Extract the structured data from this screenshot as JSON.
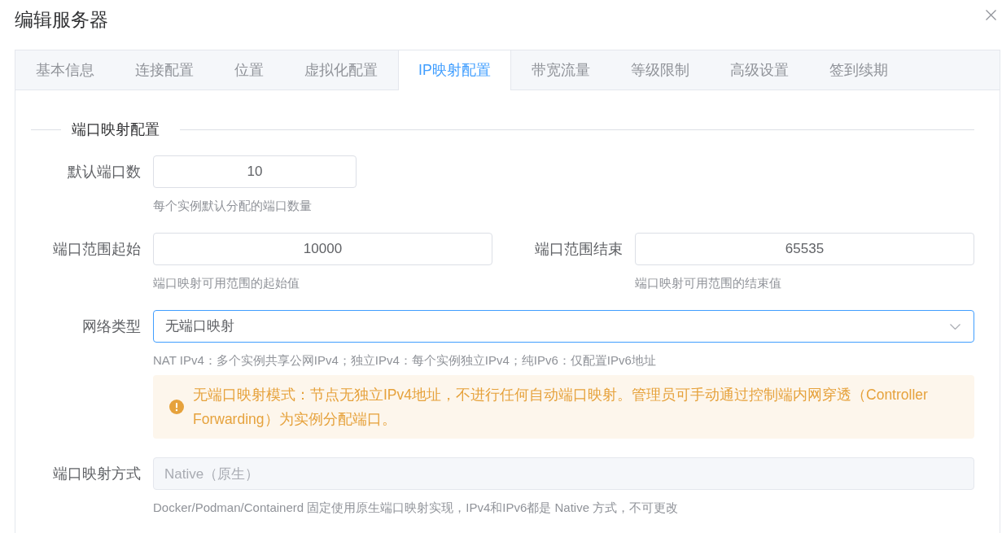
{
  "dialog": {
    "title": "编辑服务器"
  },
  "tabs": [
    {
      "label": "基本信息",
      "selected": false
    },
    {
      "label": "连接配置",
      "selected": false
    },
    {
      "label": "位置",
      "selected": false
    },
    {
      "label": "虚拟化配置",
      "selected": false
    },
    {
      "label": "IP映射配置",
      "selected": true
    },
    {
      "label": "带宽流量",
      "selected": false
    },
    {
      "label": "等级限制",
      "selected": false
    },
    {
      "label": "高级设置",
      "selected": false
    },
    {
      "label": "签到续期",
      "selected": false
    }
  ],
  "section": {
    "title": "端口映射配置"
  },
  "rows": [
    {
      "fields": [
        {
          "kind": "number",
          "label": "默认端口数",
          "value": "10",
          "hint": "每个实例默认分配的端口数量",
          "focused": false,
          "disabled": false
        }
      ]
    },
    {
      "fields": [
        {
          "kind": "number",
          "label": "端口范围起始",
          "value": "10000",
          "hint": "端口映射可用范围的起始值",
          "focused": false,
          "disabled": false
        },
        {
          "kind": "number",
          "label": "端口范围结束",
          "value": "65535",
          "hint": "端口映射可用范围的结束值",
          "focused": false,
          "disabled": false
        }
      ]
    },
    {
      "fields": [
        {
          "kind": "select",
          "label": "网络类型",
          "value": "无端口映射",
          "hint": "NAT IPv4：多个实例共享公网IPv4；独立IPv4：每个实例独立IPv4；纯IPv6：仅配置IPv6地址",
          "focused": true,
          "disabled": false,
          "alert": {
            "kind": "warning",
            "text": "无端口映射模式：节点无独立IPv4地址，不进行任何自动端口映射。管理员可手动通过控制端内网穿透（Controller Forwarding）为实例分配端口。"
          }
        }
      ]
    },
    {
      "fields": [
        {
          "kind": "text",
          "label": "端口映射方式",
          "value": "Native（原生）",
          "hint": "Docker/Podman/Containerd 固定使用原生端口映射实现，IPv4和IPv6都是 Native 方式，不可更改",
          "focused": false,
          "disabled": true
        }
      ]
    }
  ]
}
